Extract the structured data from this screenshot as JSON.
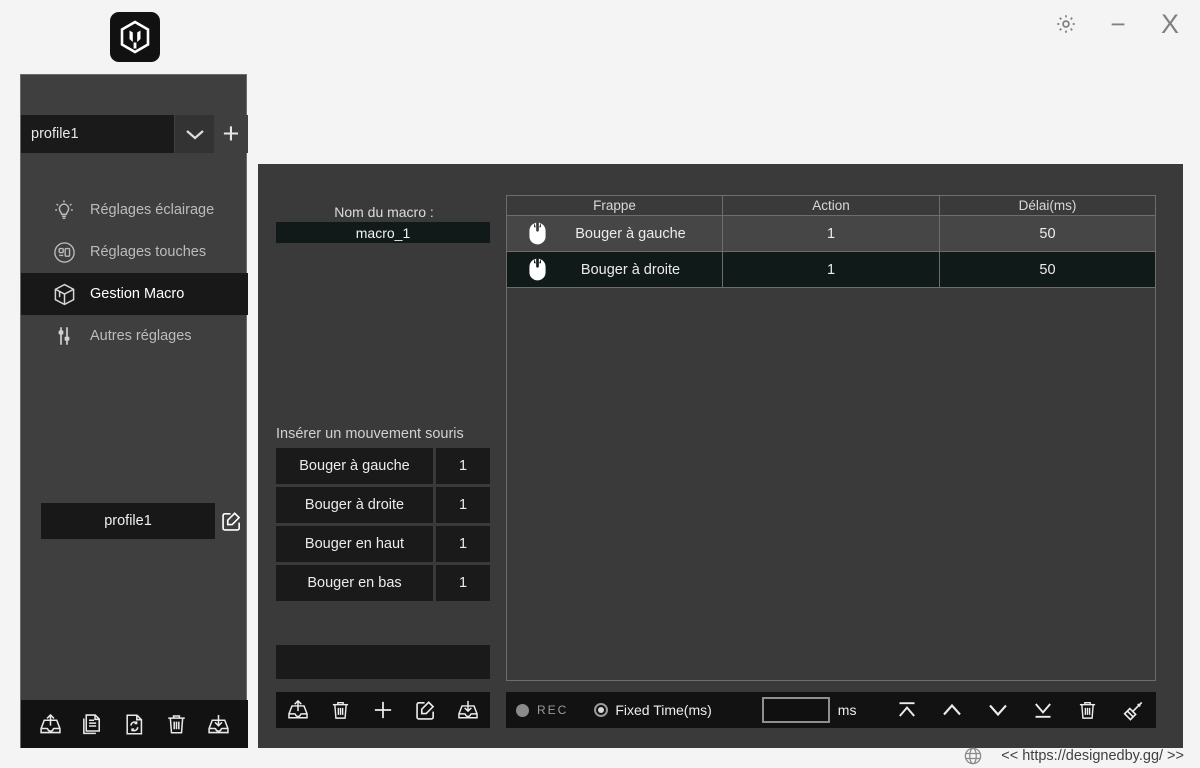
{
  "window": {
    "logo_icon": "hexagon-logo-icon",
    "settings_label": "gear-icon",
    "minimize_label": "−",
    "close_label": "X"
  },
  "sidebar": {
    "profile": {
      "value": "profile1",
      "caret_icon": "chevron-down-icon",
      "add_label": "+"
    },
    "items": [
      {
        "label": "Réglages éclairage",
        "icon": "lightbulb-icon",
        "active": false
      },
      {
        "label": "Réglages touches",
        "icon": "keyboard-circle-icon",
        "active": false
      },
      {
        "label": "Gestion Macro",
        "icon": "cube-box-icon",
        "active": true
      },
      {
        "label": "Autres réglages",
        "icon": "sliders-icon",
        "active": false
      }
    ],
    "selected_profile": {
      "label": "profile1",
      "edit_icon": "edit-pencil-icon"
    },
    "footer_icons": [
      "export-tray-icon",
      "document-copy-icon",
      "refresh-sync-icon",
      "trash-icon",
      "import-tray-icon"
    ]
  },
  "macro_panel": {
    "name_label": "Nom du macro :",
    "name_value": "macro_1",
    "insert_label": "Insérer un mouvement souris",
    "movements": [
      {
        "label": "Bouger à gauche",
        "value": "1"
      },
      {
        "label": "Bouger à droite",
        "value": "1"
      },
      {
        "label": "Bouger en haut",
        "value": "1"
      },
      {
        "label": "Bouger en bas",
        "value": "1"
      }
    ],
    "footer_icons": [
      "export-tray-icon",
      "trash-icon",
      "plus-icon",
      "edit-pencil-icon",
      "import-tray-icon"
    ]
  },
  "table": {
    "columns": [
      "Frappe",
      "Action",
      "Délai(ms)"
    ],
    "rows": [
      {
        "icon": "mouse-icon",
        "frappe": "Bouger à gauche",
        "action": "1",
        "delai": "50",
        "selected": false
      },
      {
        "icon": "mouse-icon",
        "frappe": "Bouger à droite",
        "action": "1",
        "delai": "50",
        "selected": true
      }
    ]
  },
  "bottom_bar": {
    "rec_label": "REC",
    "fixed_time_label": "Fixed Time(ms)",
    "ms_value": "",
    "ms_placeholder": "",
    "ms_unit": "ms",
    "action_icons": [
      "move-to-top-icon",
      "move-up-icon",
      "move-down-icon",
      "move-to-bottom-icon",
      "trash-icon",
      "clear-all-broom-icon"
    ]
  },
  "footer": {
    "globe_icon": "globe-icon",
    "url": "<< https://designedby.gg/ >>"
  },
  "colors": {
    "app_bg": "#f4f4f4",
    "panel_bg": "#3a3a3a",
    "sidebar_bg": "#3f3f3f",
    "dark_field": "#1a1a1a",
    "selected_row": "#101a19",
    "toolbar_bg": "#121212"
  }
}
